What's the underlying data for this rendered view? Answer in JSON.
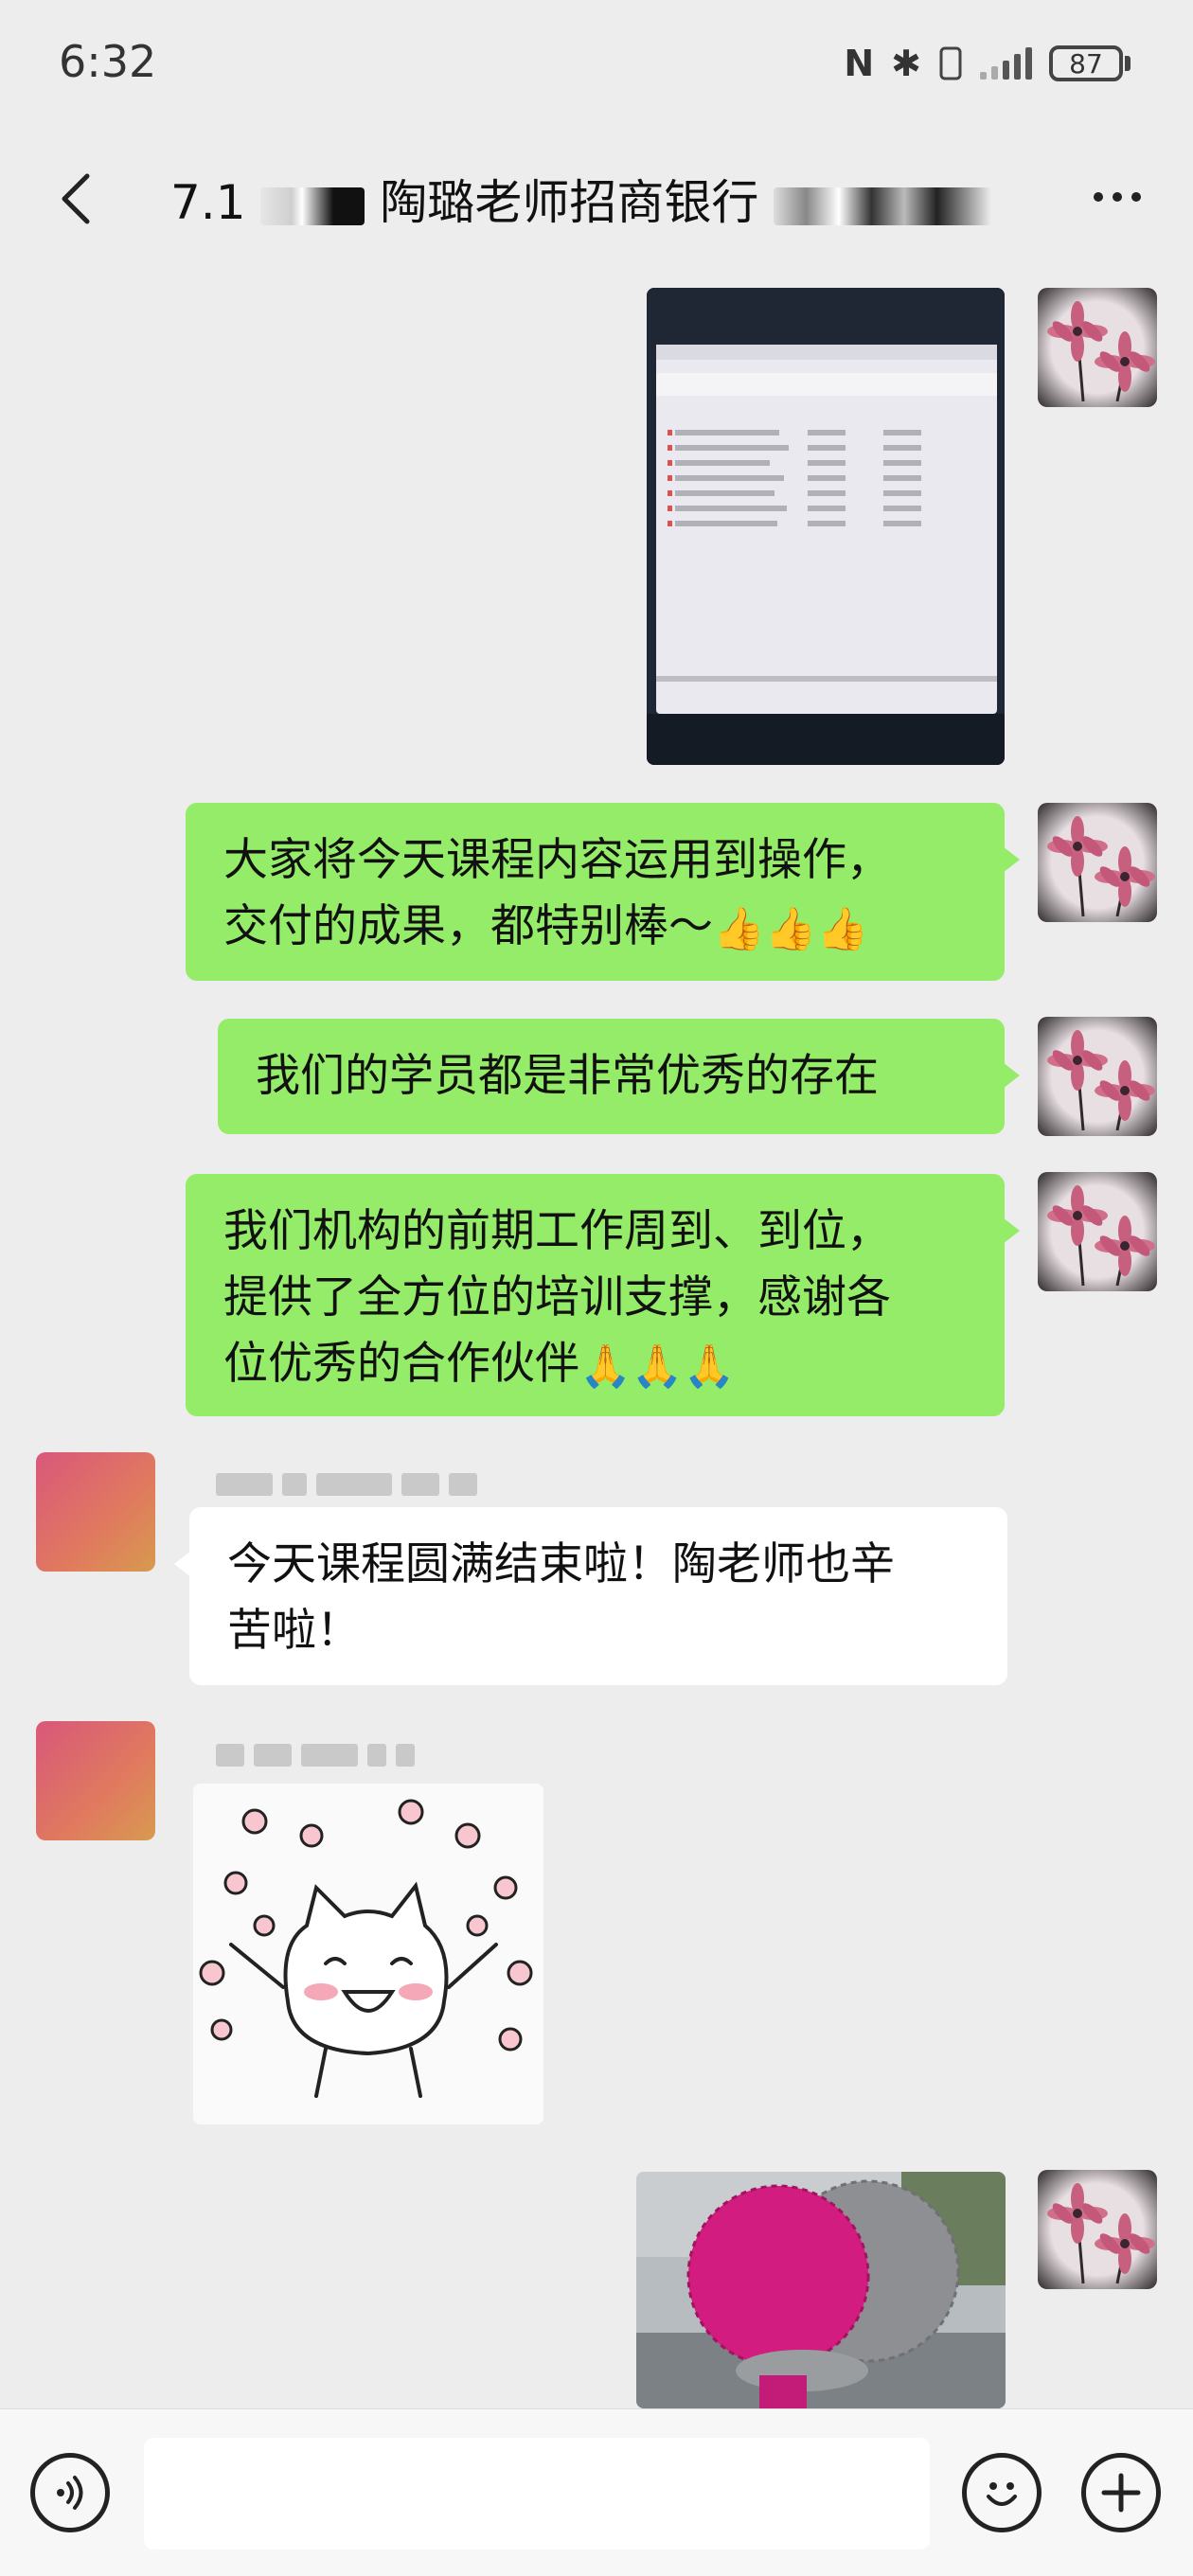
{
  "status_bar": {
    "time": "6:32",
    "nfc_icon": "N",
    "bluetooth_icon": "✱",
    "battery_level": "87"
  },
  "header": {
    "title_prefix": "7.1",
    "title_main": "陶璐老师招商银行"
  },
  "messages": [
    {
      "side": "out",
      "type": "image",
      "content": "screenshot of file list on monitor"
    },
    {
      "side": "out",
      "type": "text",
      "line1": "大家将今天课程内容运用到操作，",
      "line2": "交付的成果，都特别棒～",
      "emoji": "👍👍👍"
    },
    {
      "side": "out",
      "type": "text",
      "text": "我们的学员都是非常优秀的存在"
    },
    {
      "side": "out",
      "type": "text",
      "line1": "我们机构的前期工作周到、到位，",
      "line2": "提供了全方位的培训支撑，感谢各",
      "line3": "位优秀的合作伙伴",
      "emoji": "🙏🙏🙏"
    },
    {
      "side": "in",
      "type": "text",
      "line1": "今天课程圆满结束啦！陶老师也辛",
      "line2": "苦啦！"
    },
    {
      "side": "in",
      "type": "sticker",
      "content": "cat-cheering-sticker"
    },
    {
      "side": "out",
      "type": "image",
      "content": "crocheted-dolls-photo"
    }
  ],
  "input_bar": {
    "placeholder": ""
  },
  "colors": {
    "background": "#ededed",
    "outgoing_bubble": "#95ec69",
    "incoming_bubble": "#ffffff"
  }
}
